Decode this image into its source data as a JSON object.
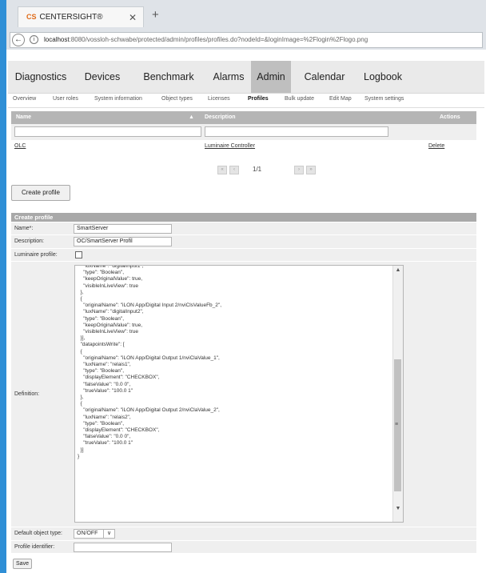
{
  "browser": {
    "tab_logo": "CS",
    "tab_title": "CENTERSIGHT®",
    "tab_close": "✕",
    "new_tab": "+",
    "back": "←",
    "info": "i",
    "url_host": "localhost",
    "url_rest": ":8080/vossloh-schwabe/protected/admin/profiles/profiles.do?nodeId=&loginImage=%2Flogin%2Flogo.png"
  },
  "nav": {
    "items": [
      "Diagnostics",
      "Devices",
      "Benchmark",
      "Alarms",
      "Admin",
      "Calendar",
      "Logbook"
    ],
    "active": "Admin"
  },
  "subnav": {
    "items": [
      "Overview",
      "User roles",
      "System information",
      "Object types",
      "Licenses",
      "Profiles",
      "Bulk update",
      "Edit Map",
      "System settings"
    ],
    "active": "Profiles"
  },
  "table": {
    "headers": {
      "name": "Name",
      "sort": "▲",
      "description": "Description",
      "actions": "Actions"
    },
    "rows": [
      {
        "name": "OLC",
        "description": "Luminaire Controller",
        "action": "Delete"
      }
    ],
    "pager": {
      "label": "1/1",
      "first": "«",
      "prev": "‹",
      "next": "›",
      "last": "»"
    }
  },
  "create_button": "Create profile",
  "form": {
    "title": "Create profile",
    "name_label": "Name*:",
    "name_value": "SmartServer",
    "description_label": "Description:",
    "description_value": "OC/SmartServer Profil",
    "luminaire_label": "Luminaire profile:",
    "definition_label": "Definition:",
    "definition_text": "    \"luxName\": \"digitalInput1\",\n    \"type\": \"Boolean\",\n    \"keepOriginalValue\": true,\n    \"visibleInLiveView\": true\n  },\n  {\n    \"originalName\": \"iLON App/Digital Input 2/nviClsValueFb_2\",\n    \"luxName\": \"digitalInput2\",\n    \"type\": \"Boolean\",\n    \"keepOriginalValue\": true,\n    \"visibleInLiveView\": true\n  }],\n  \"datapointsWrite\": [\n  {\n    \"originalName\": \"iLON App/Digital Output 1/nviClaValue_1\",\n    \"luxName\": \"relais1\",\n    \"type\": \"Boolean\",\n    \"displayElement\": \"CHECKBOX\",\n    \"falseValue\": \"0.0 0\",\n    \"trueValue\": \"100.0 1\"\n  },\n  {\n    \"originalName\": \"iLON App/Digital Output 2/nviClaValue_2\",\n    \"luxName\": \"relais2\",\n    \"type\": \"Boolean\",\n    \"displayElement\": \"CHECKBOX\",\n    \"falseValue\": \"0.0 0\",\n    \"trueValue\": \"100.0 1\"\n  }]\n}",
    "default_type_label": "Default object type:",
    "default_type_value": "ON/OFF",
    "profile_id_label": "Profile identifier:",
    "profile_id_value": ""
  },
  "save_button": "Save",
  "colors": {
    "accent_edge": "#2f8fd6",
    "active_nav": "#bfbfbf",
    "header_gray": "#b5b5b5"
  }
}
